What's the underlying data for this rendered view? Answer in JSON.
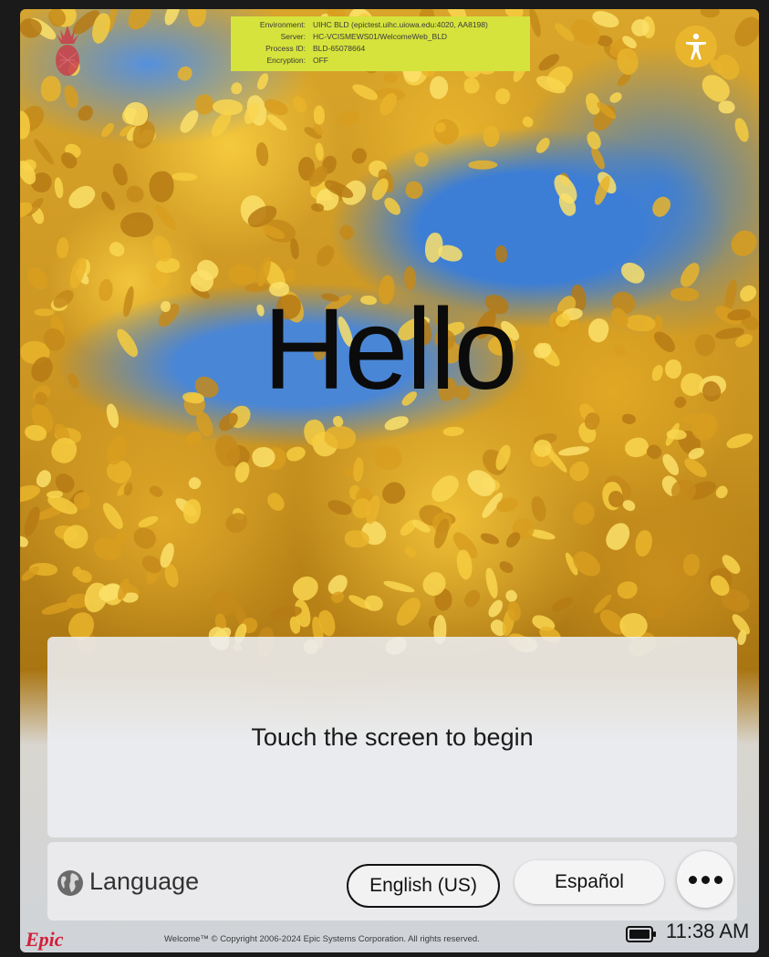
{
  "environment_banner": {
    "rows": [
      {
        "label": "Environment:",
        "value": "UIHC BLD (epictest.uihc.uiowa.edu:4020, AA8198)"
      },
      {
        "label": "Server:",
        "value": "HC-VCISMEWS01/WelcomeWeb_BLD"
      },
      {
        "label": "Process ID:",
        "value": "BLD-65078664"
      },
      {
        "label": "Encryption:",
        "value": "OFF"
      }
    ]
  },
  "icons": {
    "top_left": "pineapple-icon",
    "accessibility": "accessibility-icon",
    "language": "globe-icon",
    "more": "more-icon",
    "battery": "battery-icon"
  },
  "greeting": "Hello",
  "prompt": "Touch the screen to begin",
  "language_bar": {
    "label": "Language",
    "options": [
      "English (US)",
      "Español"
    ],
    "selected": "English (US)"
  },
  "footer": {
    "logo_text": "Epic",
    "copyright": "Welcome™ © Copyright 2006-2024 Epic Systems Corporation. All rights reserved.",
    "time": "11:38 AM"
  },
  "colors": {
    "banner": "#d6e33c",
    "accessibility_button": "#e8b52c",
    "epic_logo": "#d0203a"
  }
}
